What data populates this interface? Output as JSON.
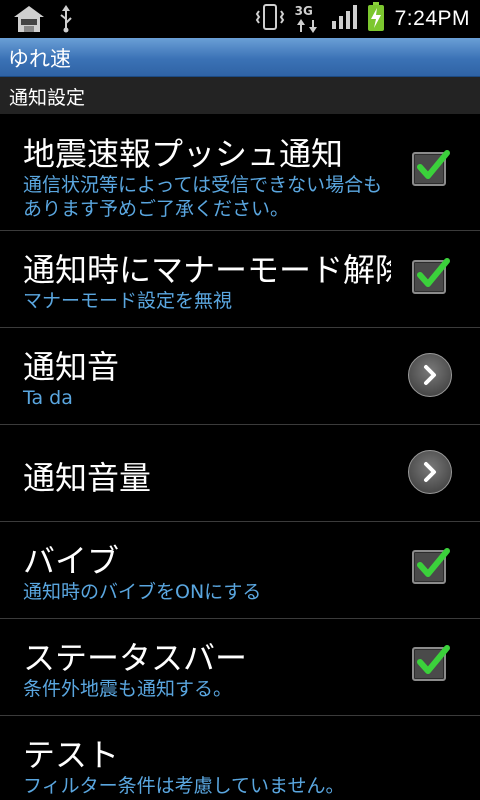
{
  "status_bar": {
    "time": "7:24PM",
    "icons": [
      "home-app-icon",
      "usb-icon",
      "vibrate-icon",
      "3g-icon",
      "signal-icon",
      "battery-charging-icon"
    ],
    "network_label": "3G"
  },
  "app": {
    "title": "ゆれ速"
  },
  "section": {
    "title": "通知設定"
  },
  "settings": [
    {
      "title": "地震速報プッシュ通知",
      "subtitle": "通信状況等によっては受信できない場合もあります予めご了承ください。",
      "control": "checkbox",
      "checked": true
    },
    {
      "title": "通知時にマナーモード解除",
      "subtitle": "マナーモード設定を無視",
      "control": "checkbox",
      "checked": true
    },
    {
      "title": "通知音",
      "subtitle": "Ta da",
      "control": "arrow"
    },
    {
      "title": "通知音量",
      "control": "arrow"
    },
    {
      "title": "バイブ",
      "subtitle": "通知時のバイブをONにする",
      "control": "checkbox",
      "checked": true
    },
    {
      "title": "ステータスバー",
      "subtitle": "条件外地震も通知する。",
      "control": "checkbox",
      "checked": true
    },
    {
      "title": "テスト",
      "subtitle": "フィルター条件は考慮していません。"
    }
  ],
  "colors": {
    "accent_blue": "#5aa6df",
    "title_bar": "#3b72b6",
    "check_green": "#3bd13b"
  }
}
